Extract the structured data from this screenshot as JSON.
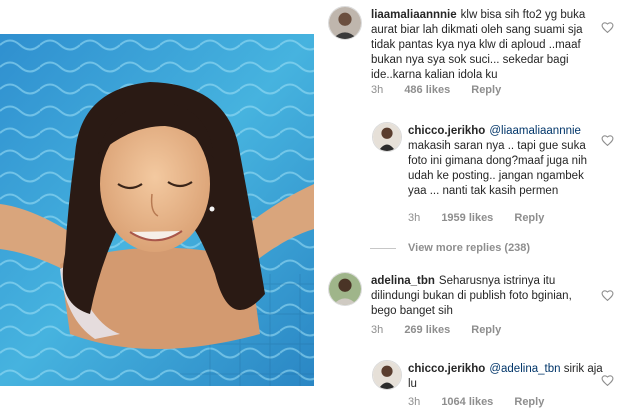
{
  "post_image": {
    "alt_icon": "photo"
  },
  "comments": [
    {
      "username": "liaamaliaannnie",
      "text": "klw bisa sih fto2 yg buka aurat biar lah dikmati oleh sang suami sja tidak pantas kya nya klw di aploud ..maaf bukan nya sya sok suci... sekedar bagi ide..karna kalian idola ku",
      "time": "3h",
      "likes": "486 likes",
      "reply_label": "Reply"
    },
    {
      "username": "chicco.jerikho",
      "mention": "@liaamaliaannnie",
      "text": " makasih saran nya .. tapi gue suka foto ini gimana dong?maaf juga nih udah ke posting.. jangan ngambek yaa ... nanti tak kasih permen",
      "time": "3h",
      "likes": "1959 likes",
      "reply_label": "Reply"
    },
    {
      "username": "adelina_tbn",
      "text": "Seharusnya istrinya itu dilindungi bukan di publish foto bginian, bego banget sih",
      "time": "3h",
      "likes": "269 likes",
      "reply_label": "Reply"
    },
    {
      "username": "chicco.jerikho",
      "mention": "@adelina_tbn",
      "text": " sirik aja lu",
      "time": "3h",
      "likes": "1064 likes",
      "reply_label": "Reply"
    }
  ],
  "view_more": {
    "label": "View more replies (238)"
  },
  "colors": {
    "pool": "#3fa6d8",
    "text": "#262626",
    "muted": "#8e8e8e",
    "link": "#003569"
  }
}
